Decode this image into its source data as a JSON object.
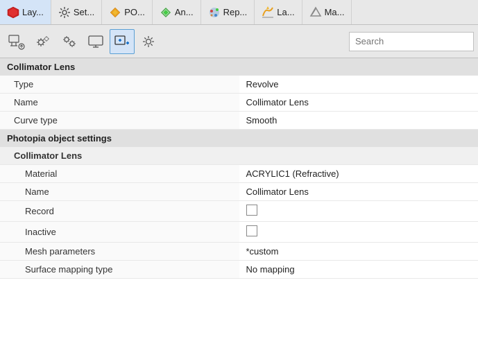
{
  "menu": {
    "items": [
      {
        "id": "layers",
        "icon": "layers",
        "label": "Lay..."
      },
      {
        "id": "settings",
        "icon": "settings",
        "label": "Set..."
      },
      {
        "id": "po",
        "icon": "po",
        "label": "PO..."
      },
      {
        "id": "analyze",
        "icon": "analyze",
        "label": "An..."
      },
      {
        "id": "report",
        "icon": "report",
        "label": "Rep..."
      },
      {
        "id": "la",
        "icon": "la",
        "label": "La..."
      },
      {
        "id": "ma",
        "icon": "ma",
        "label": "Ma..."
      }
    ]
  },
  "toolbar": {
    "buttons": [
      {
        "id": "btn1",
        "icon": "cursor-settings"
      },
      {
        "id": "btn2",
        "icon": "gears"
      },
      {
        "id": "btn3",
        "icon": "gears2"
      },
      {
        "id": "btn4",
        "icon": "screen"
      },
      {
        "id": "btn5",
        "icon": "move-add",
        "active": true
      },
      {
        "id": "btn6",
        "icon": "settings-gear"
      }
    ],
    "search_placeholder": "Search"
  },
  "section": {
    "title": "Collimator Lens",
    "properties": [
      {
        "label": "Type",
        "value": "Revolve",
        "indent": 1
      },
      {
        "label": "Name",
        "value": "Collimator Lens",
        "indent": 1
      },
      {
        "label": "Curve type",
        "value": "Smooth",
        "indent": 1
      }
    ]
  },
  "photopia_section": {
    "title": "Photopia object settings",
    "subsection": "Collimator Lens",
    "properties": [
      {
        "label": "Material",
        "value": "ACRYLIC1 (Refractive)",
        "indent": 2,
        "type": "text"
      },
      {
        "label": "Name",
        "value": "Collimator Lens",
        "indent": 2,
        "type": "text"
      },
      {
        "label": "Record",
        "value": "",
        "indent": 2,
        "type": "checkbox"
      },
      {
        "label": "Inactive",
        "value": "",
        "indent": 2,
        "type": "checkbox"
      },
      {
        "label": "Mesh parameters",
        "value": "*custom",
        "indent": 2,
        "type": "text"
      },
      {
        "label": "Surface mapping type",
        "value": "No mapping",
        "indent": 2,
        "type": "text"
      }
    ]
  }
}
